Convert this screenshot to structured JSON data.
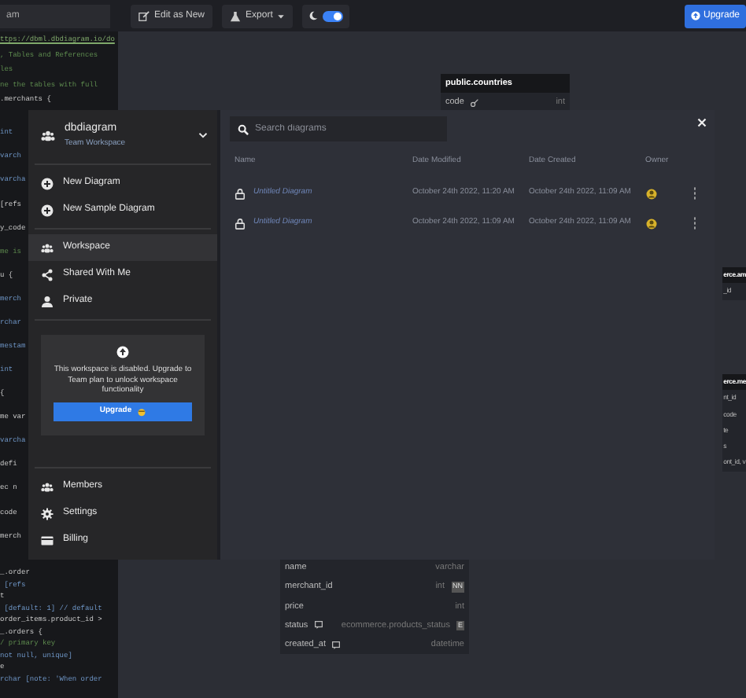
{
  "toolbar": {
    "search": {
      "value": "am"
    },
    "buttons": [
      {
        "label": "Edit as New",
        "kind": "edit"
      },
      {
        "label": "Export",
        "kind": "export"
      }
    ],
    "dark_mode": {
      "on": true
    },
    "upgrade": "Upgrade"
  },
  "editor": {
    "top_lines": [
      {
        "text": "ttps://dbml.dbdiagram.io/do",
        "kind": "link"
      },
      {
        "text": ", Tables and References",
        "kind": "comment"
      },
      {
        "text": "les",
        "kind": "comment"
      },
      {
        "text": "ne the tables with full",
        "kind": "comment"
      },
      {
        "text": ".merchants {",
        "kind": "code"
      }
    ],
    "strip_lines": [
      {
        "text": "int",
        "kind": "type"
      },
      {
        "text": "varch",
        "kind": "type"
      },
      {
        "text": "varcha",
        "kind": "type"
      },
      {
        "text": "[refs",
        "kind": "code"
      },
      {
        "text": "y_code",
        "kind": "code"
      },
      {
        "text": "me is",
        "kind": "comment"
      },
      {
        "text": "u {",
        "kind": "code"
      },
      {
        "text": "merch",
        "kind": "type"
      },
      {
        "text": "rchar",
        "kind": "type"
      },
      {
        "text": "mestam",
        "kind": "type"
      },
      {
        "text": "int",
        "kind": "type"
      },
      {
        "text": "{",
        "kind": "code"
      },
      {
        "text": "me var",
        "kind": "code"
      },
      {
        "text": "varcha",
        "kind": "type"
      },
      {
        "text": "defi",
        "kind": "code"
      },
      {
        "text": "ec n",
        "kind": "code"
      },
      {
        "text": "code",
        "kind": "code"
      },
      {
        "text": "merch",
        "kind": "code"
      }
    ],
    "bottom_lines": [
      {
        "text": "_.order",
        "kind": "code"
      },
      {
        "text": " [refs",
        "kind": "type"
      },
      {
        "text": "t",
        "kind": "code"
      },
      {
        "text": " [default: 1] // default",
        "kind": "type"
      },
      {
        "text": "order_items.product_id >",
        "kind": "code"
      },
      {
        "text": "_.orders {",
        "kind": "code"
      },
      {
        "text": "/ primary key",
        "kind": "comment"
      },
      {
        "text": "not null, unique]",
        "kind": "type"
      },
      {
        "text": "e",
        "kind": "code"
      },
      {
        "text": "rchar [note: 'When order",
        "kind": "type"
      }
    ]
  },
  "canvas": {
    "tables": [
      {
        "kind": "top",
        "header": "public.countries",
        "rows": [
          {
            "name": "code",
            "kind": "key",
            "type": "int"
          }
        ]
      },
      {
        "kind": "right-a",
        "header": "erce.am",
        "rows": [
          {
            "name": "_id"
          }
        ]
      },
      {
        "kind": "right-b",
        "header": "erce.me",
        "rows": [
          {
            "name": "nt_id"
          },
          {
            "name": "code"
          },
          {
            "name": "te"
          },
          {
            "name": "s"
          },
          {
            "name": "ont_id, v"
          }
        ]
      },
      {
        "kind": "bottom",
        "rows": [
          {
            "name": "name",
            "type": "varchar"
          },
          {
            "name": "merchant_id",
            "type": "int",
            "badge": "NN"
          },
          {
            "name": "price",
            "type": "int"
          },
          {
            "name": "status",
            "kind": "note",
            "type": "ecommerce.products_status",
            "badge": "E"
          },
          {
            "name": "created_at",
            "kind": "note",
            "type": "datetime"
          }
        ]
      }
    ]
  },
  "sidebar": {
    "workspace": {
      "name": "dbdiagram",
      "subtitle": "Team Workspace"
    },
    "actions": [
      {
        "label": "New Diagram",
        "kind": "plus"
      },
      {
        "label": "New Sample Diagram",
        "kind": "plus"
      }
    ],
    "nav": [
      {
        "label": "Workspace",
        "kind": "team",
        "selected": true
      },
      {
        "label": "Shared With Me",
        "kind": "share",
        "selected": false
      },
      {
        "label": "Private",
        "kind": "person",
        "selected": false
      }
    ],
    "notice": {
      "text": "This workspace is disabled. Upgrade to Team plan to unlock workspace functionality",
      "button": "Upgrade"
    },
    "footer": [
      {
        "label": "Members",
        "kind": "team"
      },
      {
        "label": "Settings",
        "kind": "gear"
      },
      {
        "label": "Billing",
        "kind": "card"
      }
    ]
  },
  "diagrams": {
    "search": {
      "placeholder": "Search diagrams"
    },
    "columns": [
      "Name",
      "Date Modified",
      "Date Created",
      "Owner"
    ],
    "rows": [
      {
        "name": "Untitled Diagram",
        "modified": "October 24th 2022, 11:20 AM",
        "created": "October 24th 2022, 11:09 AM"
      },
      {
        "name": "Untitled Diagram",
        "modified": "October 24th 2022, 11:09 AM",
        "created": "October 24th 2022, 11:09 AM"
      }
    ]
  }
}
